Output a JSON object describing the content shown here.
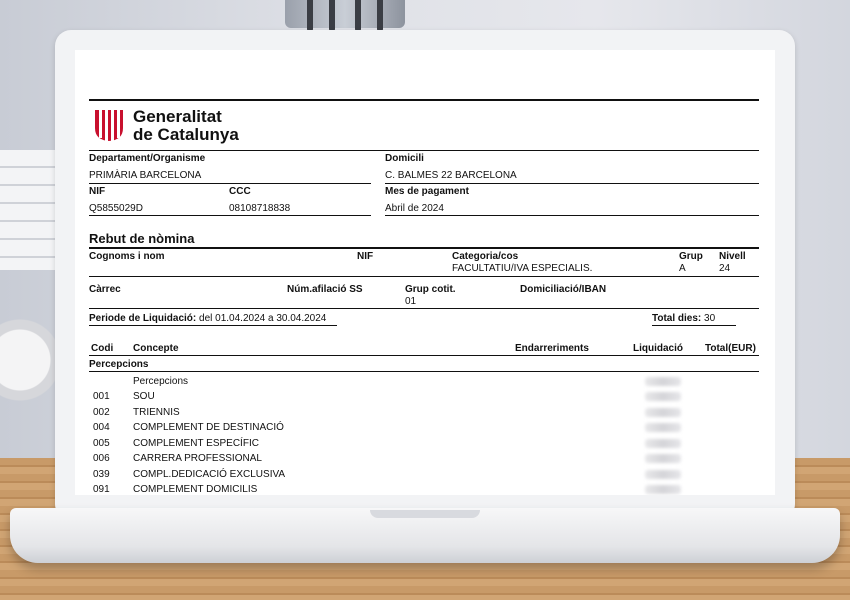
{
  "header": {
    "logo_line1": "Generalitat",
    "logo_line2": "de Catalunya"
  },
  "info": {
    "dept_label": "Departament/Organisme",
    "dept_value": "PRIMÀRIA BARCELONA",
    "domicili_label": "Domicili",
    "domicili_value": "C. BALMES 22 BARCELONA",
    "nif_label": "NIF",
    "nif_value": "Q5855029D",
    "ccc_label": "CCC",
    "ccc_value": "08108718838",
    "mes_label": "Mes de pagament",
    "mes_value": "Abril de 2024"
  },
  "rebut": {
    "title": "Rebut de nòmina",
    "cognoms_label": "Cognoms i nom",
    "nif_label": "NIF",
    "categoria_label": "Categoria/cos",
    "categoria_value": "FACULTATIU/IVA ESPECIALIS.",
    "grup_label": "Grup",
    "grup_value": "A",
    "nivell_label": "Nivell",
    "nivell_value": "24",
    "carrec_label": "Càrrec",
    "afiliacio_label": "Núm.afilació SS",
    "grupcotit_label": "Grup cotit.",
    "grupcotit_value": "01",
    "iban_label": "Domiciliació/IBAN",
    "periode_label": "Periode de Liquidació:",
    "periode_value": "del 01.04.2024 a 30.04.2024",
    "totaldies_label": "Total dies:",
    "totaldies_value": "30"
  },
  "table": {
    "headers": [
      "Codi",
      "Concepte",
      "Endarreriments",
      "Liquidació",
      "Total(EUR)"
    ],
    "section_label": "Percepcions",
    "subsection_label": "Percepcions",
    "rows": [
      {
        "code": "001",
        "concept": "SOU"
      },
      {
        "code": "002",
        "concept": "TRIENNIS"
      },
      {
        "code": "004",
        "concept": "COMPLEMENT DE DESTINACIÓ"
      },
      {
        "code": "005",
        "concept": "COMPLEMENT ESPECÍFIC"
      },
      {
        "code": "006",
        "concept": "CARRERA PROFESSIONAL"
      },
      {
        "code": "039",
        "concept": "COMPL.DEDICACIÓ EXCLUSIVA"
      },
      {
        "code": "091",
        "concept": "COMPLEMENT DOMICILIS"
      }
    ]
  },
  "colors": {
    "logo_red": "#c8102e",
    "desk": "#c89a68"
  }
}
